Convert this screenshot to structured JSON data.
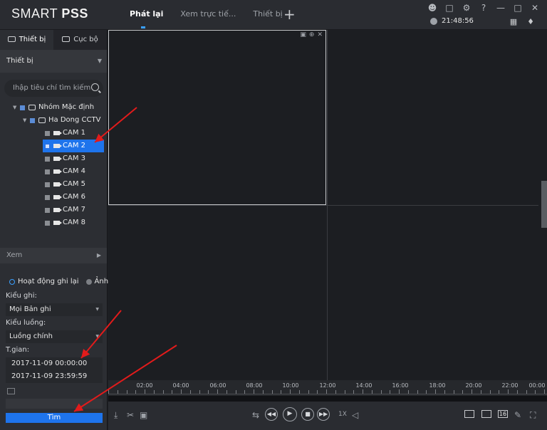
{
  "app": {
    "brand_light": "SMART ",
    "brand_bold": "PSS",
    "tabs": [
      "Phát lại",
      "Xem trực tiế...",
      "Thiết bị"
    ],
    "add_tab": "+",
    "clock": "21:48:56"
  },
  "sidebar": {
    "tab_device": "Thiết bị",
    "tab_local": "Cục bộ",
    "device_select": "Thiết bị",
    "search_placeholder": "Ihập tiêu chí tìm kiếm",
    "tree": {
      "group": "Nhóm Mặc định",
      "device": "Ha Dong CCTV",
      "cameras": [
        "CAM 1",
        "CAM 2",
        "CAM 3",
        "CAM 4",
        "CAM 5",
        "CAM 6",
        "CAM 7",
        "CAM 8"
      ],
      "selected_camera": "CAM 2"
    },
    "view_section": "Xem",
    "radio_record": "Hoạt động ghi lại",
    "radio_image": "Ảnh",
    "record_type_label": "Kiểu ghi:",
    "record_type_value": "Mọi Bản ghi",
    "stream_type_label": "Kiểu luồng:",
    "stream_type_value": "Luồng chính",
    "time_label": "T.gian:",
    "time_start": "2017-11-09 00:00:00",
    "time_end": "2017-11-09 23:59:59",
    "search_button": "Tìm"
  },
  "timeline": {
    "labels": [
      "02:00",
      "04:00",
      "06:00",
      "08:00",
      "10:00",
      "12:00",
      "14:00",
      "16:00",
      "18:00",
      "20:00",
      "22:00",
      "00:00"
    ]
  },
  "controls": {
    "speed": "1X",
    "layout_16": "16"
  }
}
